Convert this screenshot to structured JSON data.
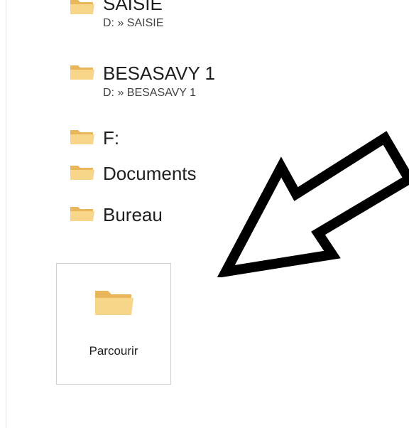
{
  "folders": [
    {
      "name": "SAISIE",
      "path": "D: » SAISIE",
      "icon": "folder-icon"
    },
    {
      "name": "BESASAVY 1",
      "path": "D: » BESASAVY 1",
      "icon": "folder-icon"
    },
    {
      "name": "F:",
      "icon": "folder-icon"
    },
    {
      "name": "Documents",
      "icon": "folder-icon"
    },
    {
      "name": "Bureau",
      "icon": "folder-icon"
    }
  ],
  "browse": {
    "label": "Parcourir",
    "icon": "folder-icon"
  },
  "annotation": {
    "icon": "arrow-pointing-down-left-icon",
    "color": "#000000"
  },
  "colors": {
    "folder_body": "#f0c26a",
    "folder_front": "#f7d88d",
    "tile_border": "#cfcfcf"
  }
}
